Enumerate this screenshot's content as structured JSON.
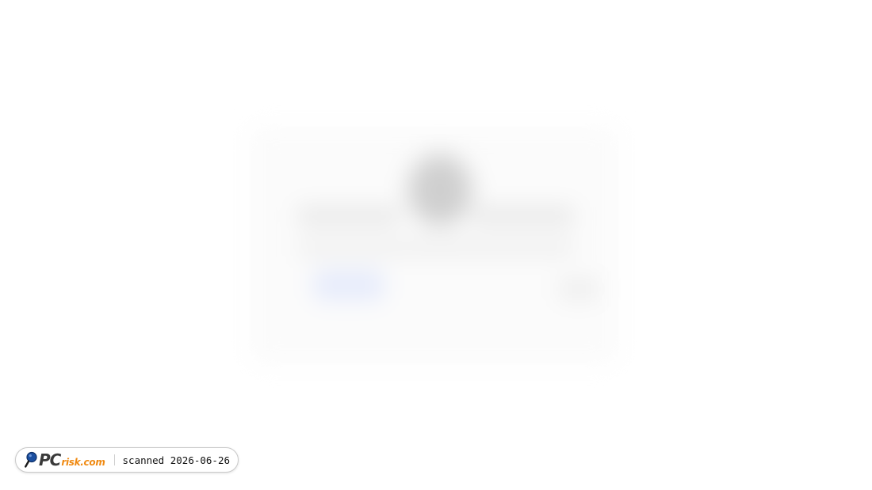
{
  "blurred_content": {
    "description_visible": false
  },
  "badge": {
    "logo_icon": "magnifier-icon",
    "logo_text_main": "PC",
    "logo_text_domain": "risk.com",
    "scan_label": "scanned 2026-06-26",
    "colors": {
      "logo_main": "#3a3a3a",
      "logo_domain": "#f08a12",
      "magnifier": "#1b4fa0"
    }
  }
}
